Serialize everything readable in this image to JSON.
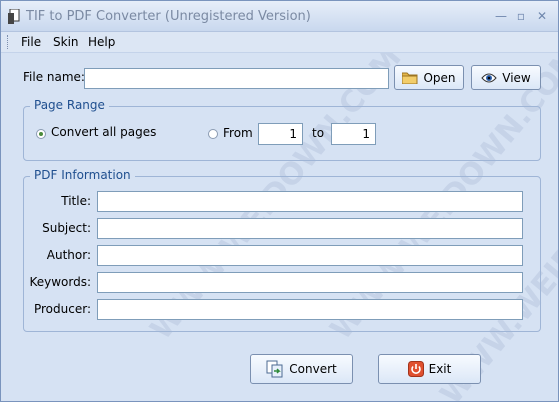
{
  "window": {
    "title": "TIF to PDF Converter (Unregistered Version)"
  },
  "menu": [
    {
      "label": "File"
    },
    {
      "label": "Skin"
    },
    {
      "label": "Help"
    }
  ],
  "file": {
    "label": "File name:",
    "value": "",
    "open_label": "Open",
    "view_label": "View"
  },
  "page_range": {
    "legend": "Page Range",
    "all_pages_label": "Convert all pages",
    "from_label": "From",
    "from_value": "1",
    "to_label": "to",
    "to_value": "1",
    "selected": "all"
  },
  "pdf_info": {
    "legend": "PDF Information",
    "fields": [
      {
        "label": "Title:",
        "value": ""
      },
      {
        "label": "Subject:",
        "value": ""
      },
      {
        "label": "Author:",
        "value": ""
      },
      {
        "label": "Keywords:",
        "value": ""
      },
      {
        "label": "Producer:",
        "value": ""
      }
    ]
  },
  "actions": {
    "convert_label": "Convert",
    "exit_label": "Exit"
  },
  "watermark": [
    "WWW.WEIDOWN.COM",
    "WWW.WEIDOWN.COM",
    "WWW.WEIDOWN.COM"
  ],
  "colors": {
    "accent_text": "#1f4f8f",
    "window_bg": "#d6e2f3"
  }
}
